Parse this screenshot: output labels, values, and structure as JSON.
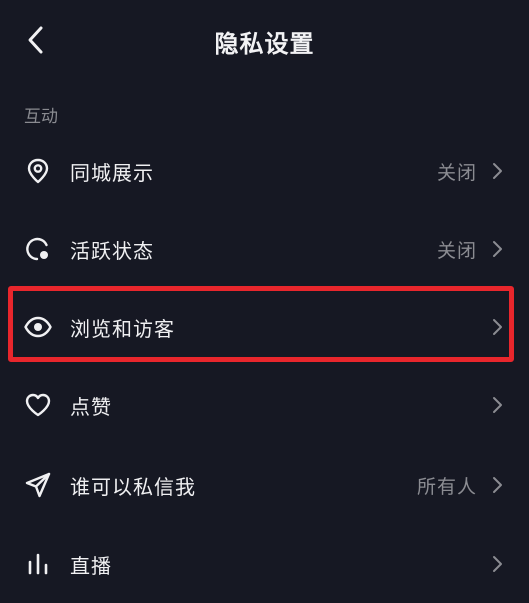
{
  "header": {
    "title": "隐私设置",
    "back_icon": "chevron-left-icon"
  },
  "section": {
    "title": "互动"
  },
  "rows": [
    {
      "icon": "location-pin-icon",
      "label": "同城展示",
      "value": "关闭"
    },
    {
      "icon": "activity-status-icon",
      "label": "活跃状态",
      "value": "关闭"
    },
    {
      "icon": "eye-icon",
      "label": "浏览和访客",
      "value": ""
    },
    {
      "icon": "heart-icon",
      "label": "点赞",
      "value": ""
    },
    {
      "icon": "send-icon",
      "label": "谁可以私信我",
      "value": "所有人"
    },
    {
      "icon": "bar-chart-icon",
      "label": "直播",
      "value": ""
    }
  ],
  "colors": {
    "background": "#161823",
    "highlight": "#e8262c",
    "secondary_text": "#8b8c92"
  }
}
